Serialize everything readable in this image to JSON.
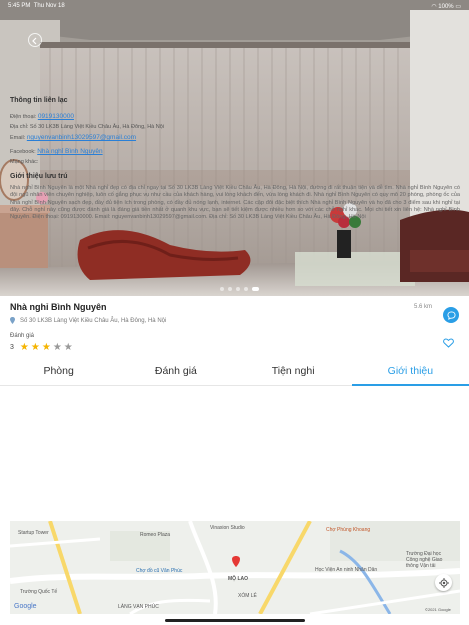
{
  "status_bar": {
    "time": "5:45 PM",
    "date": "Thu Nov 18",
    "battery": "100%"
  },
  "hotel": {
    "name": "Nhà nghỉ Bình Nguyên",
    "address": "Số 30 LK3B Làng Việt Kiều Châu Âu, Hà Đông, Hà Nội",
    "distance": "5.6 km",
    "rating_label": "Đánh giá",
    "rating_value": "3",
    "rating_stars": 3,
    "rating_max": 5
  },
  "tabs": [
    {
      "label": "Phòng",
      "active": false
    },
    {
      "label": "Đánh giá",
      "active": false
    },
    {
      "label": "Tiện nghi",
      "active": false
    },
    {
      "label": "Giới thiệu",
      "active": true
    }
  ],
  "contact": {
    "title": "Thông tin liên lạc",
    "phone_label": "Điện thoại:",
    "phone": "0919130000",
    "address_label": "Địa chỉ:",
    "address": "Số 30 LK3B Làng Việt Kiều Châu Âu, Hà Đông, Hà Nội",
    "email_label": "Email:",
    "email": "nguyenvanbinh13029597@gmail.com",
    "facebook_label": "Facebook:",
    "facebook": "Nhà nghỉ Bình Nguyên",
    "other": "Mạng khác:"
  },
  "intro": {
    "title": "Giới thiệu lưu trú",
    "text": "Nhà nghỉ Bình Nguyên là một Nhà nghỉ đẹp có địa chỉ ngay tại Số 30 LK3B Làng Việt Kiều Châu Âu, Hà Đông, Hà Nội, đường đi rất thuận tiện và dễ tìm. Nhà nghỉ Bình Nguyên có đội ngũ nhân viên chuyên nghiệp, luôn cố gắng phục vụ như cầu của khách hàng, vui lòng khách đến, vừa lòng khách đi. Nhà nghỉ Bình Nguyên có quy mô 20 phòng, phòng ốc của Nhà nghỉ Bình Nguyên sạch đẹp, đầy đủ tiện ích trong phòng, có đầy đủ nóng lạnh, internet. Các cặp đôi đặc biệt thích Nhà nghỉ Bình Nguyên và họ đã cho 3 điểm sau khi nghỉ tại đây. Chỗ nghỉ này cũng được đánh giá là đáng giá tiền nhất ở quanh khu vực, bạn sẽ tiết kiệm được nhiều hơn so với các chỗ nghỉ khác. Mọi chi tiết xin liên hệ: Nhà nghỉ Bình Nguyên. Điện thoại: 0919130000. Email: nguyenvanbinh13029597@gmail.com. Địa chỉ: Số 30 LK3B Làng Việt Kiều Châu Âu, Hà Đông, Hà Nội"
  },
  "map": {
    "labels": [
      "Startup Tower",
      "Romeo Plaza",
      "Vinaxion Studio",
      "Chợ Phùng Khoang",
      "Chợ đồ cũ Văn Phúc",
      "MỘ LAO",
      "XÓM LẺ",
      "Học Viện An ninh Nhân Dân",
      "Trường Đại học Công nghệ Giao thông Vận tải",
      "Trường Quốc Tế",
      "LÀNG VẠN PHÚC",
      "Google",
      "©2021 Google"
    ]
  },
  "colors": {
    "accent": "#2a9ee6",
    "star": "#f5b400"
  }
}
